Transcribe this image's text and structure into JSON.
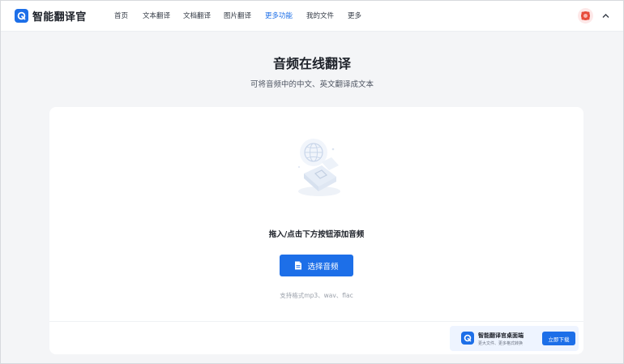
{
  "header": {
    "brand_name": "智能翻译官",
    "nav": [
      {
        "label": "首页",
        "active": false
      },
      {
        "label": "文本翻译",
        "active": false
      },
      {
        "label": "文档翻译",
        "active": false
      },
      {
        "label": "图片翻译",
        "active": false
      },
      {
        "label": "更多功能",
        "active": true
      },
      {
        "label": "我的文件",
        "active": false
      },
      {
        "label": "更多",
        "active": false
      }
    ],
    "user_menu_icon": "chevron-up-icon"
  },
  "main": {
    "title": "音频在线翻译",
    "subtitle": "可将音频中的中文、英文翻译成文本",
    "upload": {
      "drop_text": "拖入/点击下方按钮添加音频",
      "button_label": "选择音频",
      "button_icon": "file-icon",
      "formats_text": "支持格式mp3、wav、flac"
    }
  },
  "promo": {
    "title": "智能翻译官桌面端",
    "description": "更大文件、更多格式转换",
    "button_label": "立即下载"
  },
  "colors": {
    "accent": "#1d6fe8",
    "background": "#f4f5f7",
    "card": "#ffffff"
  }
}
